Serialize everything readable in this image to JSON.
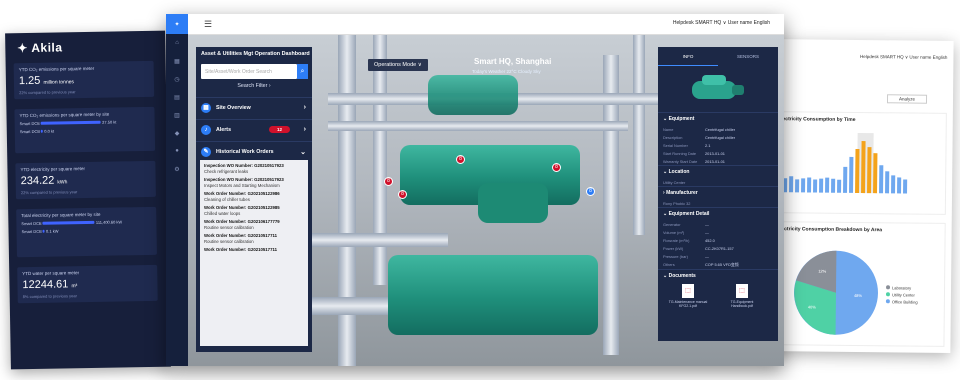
{
  "left_card": {
    "logo": "Akila",
    "kpis": [
      {
        "title": "YTD CO₂ emissions per square meter",
        "value": "1.25",
        "unit": "million tonnes",
        "delta": "22% compared to previous year"
      },
      {
        "title": "YTD electricity per square meter",
        "value": "234.22",
        "unit": "kWh",
        "delta": "22% compared to previous year"
      },
      {
        "title": "YTD water per square meter",
        "value": "12244.61",
        "unit": "m³",
        "delta": "8% compared to previous year"
      }
    ],
    "site_title": "YTD CO₂ emissions per square meter by site",
    "sites": [
      {
        "name": "Smart DCE",
        "val": "27.50 kt"
      },
      {
        "name": "Smart DCB",
        "val": "0.0 kt"
      }
    ],
    "elec_title": "Total electricity per square meter by site",
    "elec_sites": [
      {
        "name": "Smart DCE",
        "val": "111,400.60 kW"
      },
      {
        "name": "Smart DCB",
        "val": "0.1 kW"
      }
    ]
  },
  "right_card": {
    "header": "Helpdesk   SMART HQ ∨   User name   English",
    "analyze_btn": "Analyze",
    "chart1_title": "Electricity Consumption by Time",
    "chart2_title": "Electricity Consumption Breakdown by Area",
    "legend": [
      "Laboratory",
      "Utility Center",
      "Office Building"
    ],
    "pie_labels": [
      "12%",
      "40%",
      "48%"
    ]
  },
  "main": {
    "topbar_right": "Helpdesk   SMART HQ ∨   User name   English",
    "panel_title": "Asset & Utilities Mgt Operation Dashboard",
    "search_placeholder": "Site/Asset/Work Order Search",
    "search_filter": "Search Filter ›",
    "sections": {
      "site": "Site Overview",
      "alerts": "Alerts",
      "alerts_count": "12",
      "history": "Historical Work Orders"
    },
    "orders": [
      {
        "n": "Inspection WO Number: G20210517923",
        "s": "Check refrigerant leaks"
      },
      {
        "n": "Inspection WO Number: G20210517923",
        "s": "Inspect Motors and Starting Mechanism"
      },
      {
        "n": "Work Order Number: G202105122986",
        "s": "Cleaning of chiller tubes"
      },
      {
        "n": "Work Order Number: G202105122985",
        "s": "Chilled water loops"
      },
      {
        "n": "Work Order Number: G202106177779",
        "s": "Routine sensor calibration"
      },
      {
        "n": "Work Order Number: G20210517711",
        "s": "Routine sensor calibration"
      },
      {
        "n": "Work Order Number: G20210517711",
        "s": ""
      }
    ],
    "op_mode": "Operations Mode ∨",
    "place": "Smart HQ, Shanghai",
    "weather": "Today's Weather 22°C Cloudy Sky",
    "right_tabs": [
      "INFO",
      "SENSORS"
    ],
    "equipment_header": "Equipment",
    "equipment": [
      {
        "k": "Name",
        "v": "Centrifugal chiller"
      },
      {
        "k": "Description",
        "v": "Centrifugal chiller"
      },
      {
        "k": "Serial Number",
        "v": "2.1"
      },
      {
        "k": "Start Running Date",
        "v": "2013-01-01"
      },
      {
        "k": "Warranty Start Date",
        "v": "2013-01-01"
      }
    ],
    "location_header": "Location",
    "location_value": "Utility Center",
    "manufacturer_header": "Manufacturer",
    "manufacturer_value": "Rony Phobic 32",
    "detail_header": "Equipment Detail",
    "details": [
      {
        "k": "Generator",
        "v": "—"
      },
      {
        "k": "Volume (m³)",
        "v": "—"
      },
      {
        "k": "Flowrate (m³/h)",
        "v": "452.0"
      },
      {
        "k": "Power (kW)",
        "v": "CC-2K07R1-157"
      },
      {
        "k": "Pressure (bar)",
        "v": "—"
      },
      {
        "k": "Others",
        "v": "COP 5.65 VFD变频"
      }
    ],
    "documents_header": "Documents",
    "docs": [
      "TG-Maintenance manual KFG2.1.pdf",
      "TG-Equipment Handbook.pdf"
    ],
    "markers": [
      "8",
      "8",
      "8",
      "8",
      "8"
    ]
  }
}
